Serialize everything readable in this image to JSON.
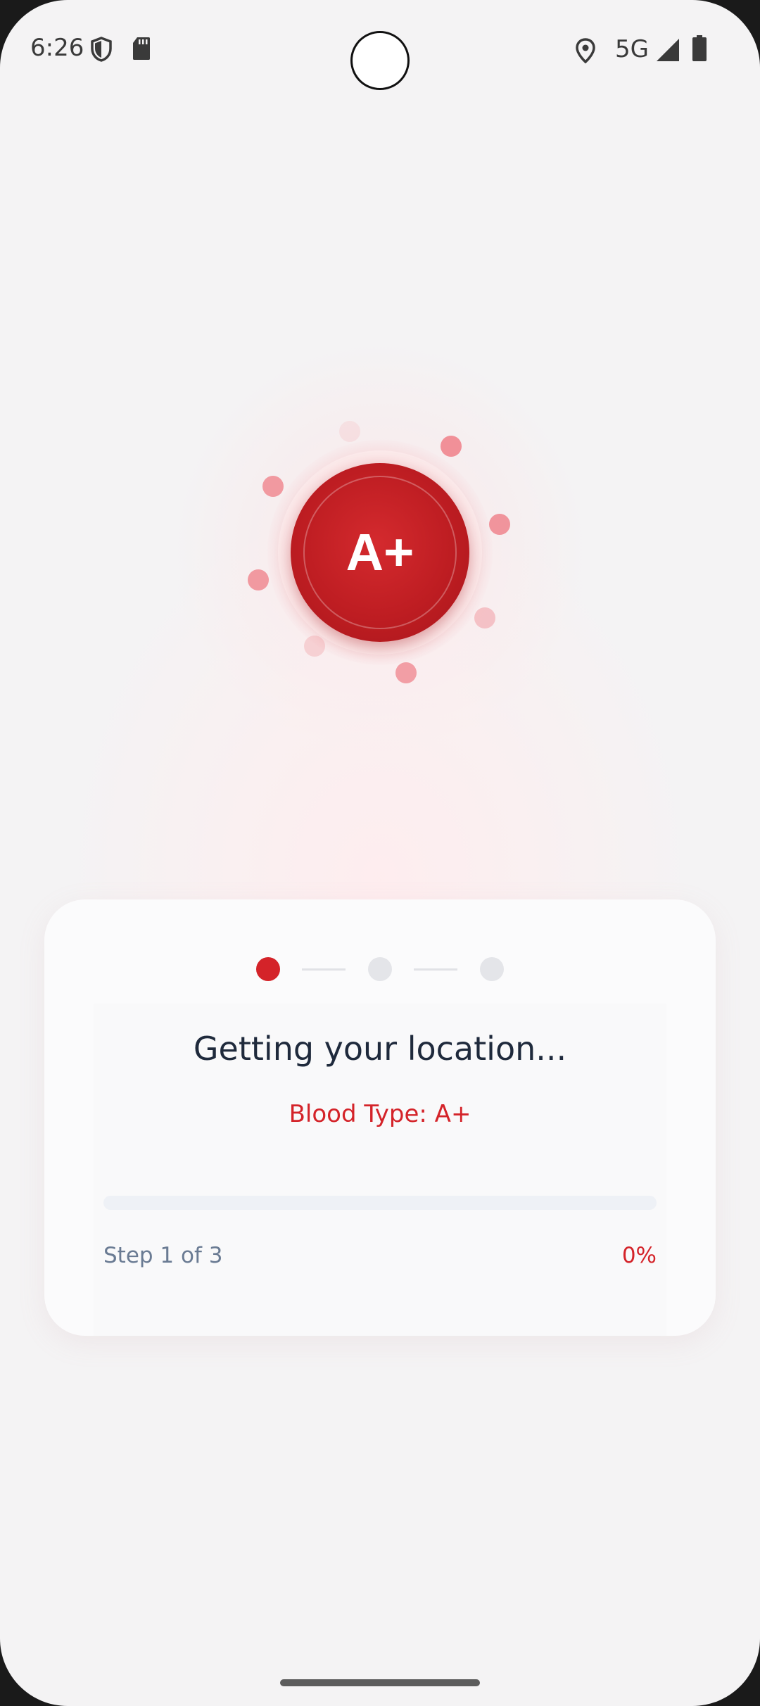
{
  "status_bar": {
    "time": "6:26",
    "network": "5G",
    "icons": [
      "shield-icon",
      "sd-card-icon",
      "location-icon",
      "signal-icon",
      "battery-icon"
    ]
  },
  "badge": {
    "blood_type": "A+",
    "color": "#c41e23"
  },
  "card": {
    "title": "Getting your location...",
    "subtitle": "Blood Type: A+",
    "steps_total": 3,
    "current_step": 1,
    "step_text": "Step 1 of 3",
    "progress_text": "0%",
    "progress_fraction": 0,
    "accent_color": "#d42329",
    "inactive_color": "#e4e5e9"
  }
}
